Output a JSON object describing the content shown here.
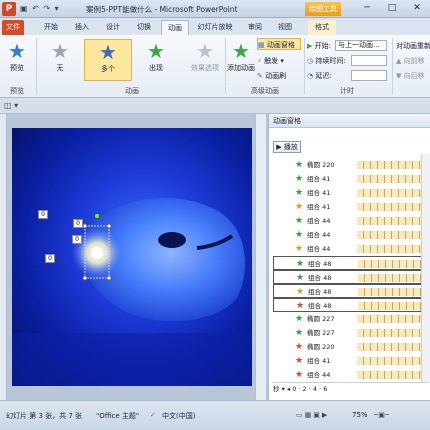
{
  "title_bar": {
    "app_icon": "P",
    "qat": "▣ ↶ ↷ ▾",
    "window_title": "案例5-PPT能做什么 - Microsoft PowerPoint",
    "context_tab_label": "绘图工具",
    "min": "─",
    "max": "□",
    "close": "✕"
  },
  "tabs": [
    {
      "label": "文件"
    },
    {
      "label": "开始"
    },
    {
      "label": "插入"
    },
    {
      "label": "设计"
    },
    {
      "label": "切换"
    },
    {
      "label": "动画"
    },
    {
      "label": "幻灯片放映"
    },
    {
      "label": "审阅"
    },
    {
      "label": "视图"
    },
    {
      "label": "格式"
    }
  ],
  "ribbon": {
    "preview": {
      "label": "预览",
      "group": "预览"
    },
    "effects": [
      {
        "label": "无"
      },
      {
        "label": "多个"
      },
      {
        "label": "出现"
      }
    ],
    "effect_options": "效果选项",
    "group_animation": "动画",
    "add_animation": "添加动画",
    "anim_pane": "动画窗格",
    "trigger": "触发 ▾",
    "anim_painter": "动画刷",
    "group_advanced": "高级动画",
    "start_label": "开始:",
    "start_value": "与上一动画...",
    "duration_label": "持续时间:",
    "delay_label": "延迟:",
    "group_timing": "计时",
    "reorder": "对动画重新",
    "move_earlier": "▲ 向前移",
    "move_later": "▼ 向后移"
  },
  "slide_markers": [
    "0",
    "0",
    "0",
    "0"
  ],
  "anim_pane": {
    "title": "动画窗格",
    "play_label": "▶ 播放",
    "rows": [
      {
        "num": "",
        "icon": "green",
        "name": "椭圆 220",
        "boxed": false
      },
      {
        "num": "",
        "icon": "green",
        "name": "组合 41",
        "boxed": false
      },
      {
        "num": "",
        "icon": "green",
        "name": "组合 41",
        "boxed": false
      },
      {
        "num": "",
        "icon": "multi",
        "name": "组合 41",
        "boxed": false
      },
      {
        "num": "",
        "icon": "green",
        "name": "组合 44",
        "boxed": false
      },
      {
        "num": "",
        "icon": "green",
        "name": "组合 44",
        "boxed": false
      },
      {
        "num": "",
        "icon": "multi",
        "name": "组合 44",
        "boxed": false
      },
      {
        "num": "",
        "icon": "green",
        "name": "组合 48",
        "boxed": true
      },
      {
        "num": "",
        "icon": "green",
        "name": "组合 48",
        "boxed": true
      },
      {
        "num": "",
        "icon": "multi",
        "name": "组合 48",
        "boxed": true
      },
      {
        "num": "",
        "icon": "red",
        "name": "组合 48",
        "boxed": true
      },
      {
        "num": "",
        "icon": "green",
        "name": "椭圆 227",
        "boxed": false
      },
      {
        "num": "",
        "icon": "green",
        "name": "椭圆 227",
        "boxed": false
      },
      {
        "num": "",
        "icon": "red",
        "name": "椭圆 220",
        "boxed": false
      },
      {
        "num": "",
        "icon": "red",
        "name": "组合 41",
        "boxed": false
      },
      {
        "num": "",
        "icon": "red",
        "name": "组合 44",
        "boxed": false
      }
    ],
    "seconds_bar": "秒 ▾ ◂ 0 · 2 · 4 · 6"
  },
  "status_bar": {
    "slide_info": "幻灯片 第 3 张，共 7 张",
    "theme": "\"Office 主题\"",
    "language": "中文(中国)",
    "zoom": "75%"
  },
  "colors": {
    "file_tab": "#d64a25",
    "selected_effect": "#fde89d",
    "context_tab": "#f0b232"
  }
}
